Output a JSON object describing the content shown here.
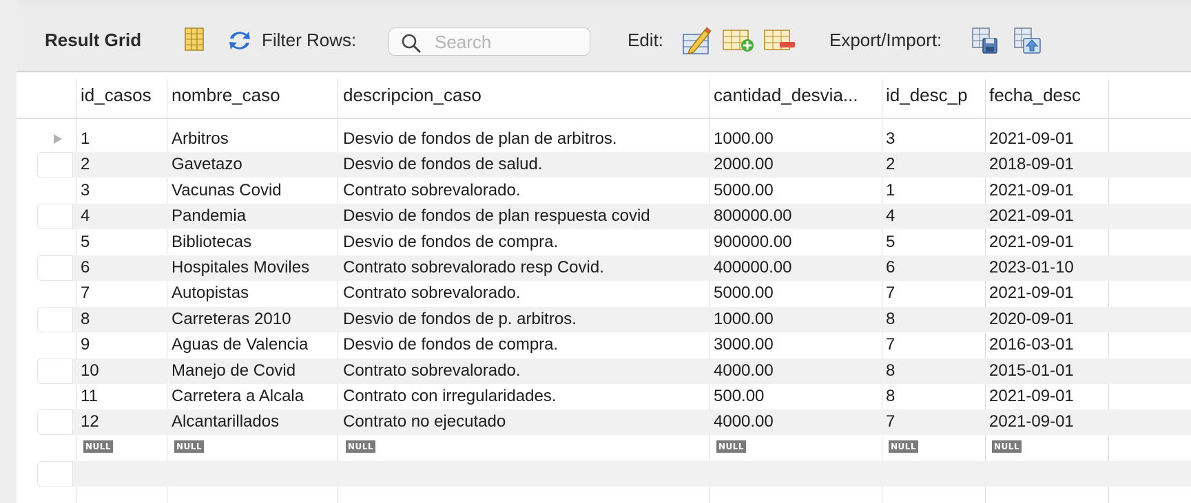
{
  "toolbar": {
    "title": "Result Grid",
    "filter_label": "Filter Rows:",
    "search_placeholder": "Search",
    "edit_label": "Edit:",
    "export_label": "Export/Import:"
  },
  "columns": [
    "id_casos",
    "nombre_caso",
    "descripcion_caso",
    "cantidad_desvia...",
    "id_desc_p",
    "fecha_desc"
  ],
  "rows": [
    [
      "1",
      "Arbitros",
      "Desvio  de fondos de plan de arbitros.",
      "1000.00",
      "3",
      "2021-09-01"
    ],
    [
      "2",
      "Gavetazo",
      "Desvio  de fondos de salud.",
      "2000.00",
      "2",
      "2018-09-01"
    ],
    [
      "3",
      "Vacunas Covid",
      "Contrato sobrevalorado.",
      "5000.00",
      "1",
      "2021-09-01"
    ],
    [
      "4",
      "Pandemia",
      "Desvio  de fondos de plan respuesta covid",
      "800000.00",
      "4",
      "2021-09-01"
    ],
    [
      "5",
      "Bibliotecas",
      "Desvio  de fondos de compra.",
      "900000.00",
      "5",
      "2021-09-01"
    ],
    [
      "6",
      "Hospitales Moviles",
      "Contrato sobrevalorado resp Covid.",
      "400000.00",
      "6",
      "2023-01-10"
    ],
    [
      "7",
      "Autopistas",
      "Contrato sobrevalorado.",
      "5000.00",
      "7",
      "2021-09-01"
    ],
    [
      "8",
      "Carreteras 2010",
      "Desvio  de fondos de p. arbitros.",
      "1000.00",
      "8",
      "2020-09-01"
    ],
    [
      "9",
      "Aguas de Valencia",
      "Desvio  de fondos de compra.",
      "3000.00",
      "7",
      "2016-03-01"
    ],
    [
      "10",
      "Manejo de Covid",
      "Contrato sobrevalorado.",
      "4000.00",
      "8",
      "2015-01-01"
    ],
    [
      "11",
      "Carretera a Alcala",
      "Contrato con irregularidades.",
      "500.00",
      "8",
      "2021-09-01"
    ],
    [
      "12",
      "Alcantarillados",
      "Contrato no ejecutado",
      "4000.00",
      "7",
      "2021-09-01"
    ]
  ],
  "null_label": "NULL",
  "colors": {
    "toolbar_bg": "#ececec",
    "alt_row_bg": "#f1f1f1",
    "null_badge_bg": "#7b7b7b",
    "icon_blue": "#2f6fd3",
    "icon_yellow": "#f3c54a"
  },
  "icons": [
    "grid-layout-icon",
    "refresh-icon",
    "search-icon",
    "edit-row-icon",
    "add-row-icon",
    "delete-row-icon",
    "export-icon",
    "import-icon"
  ]
}
